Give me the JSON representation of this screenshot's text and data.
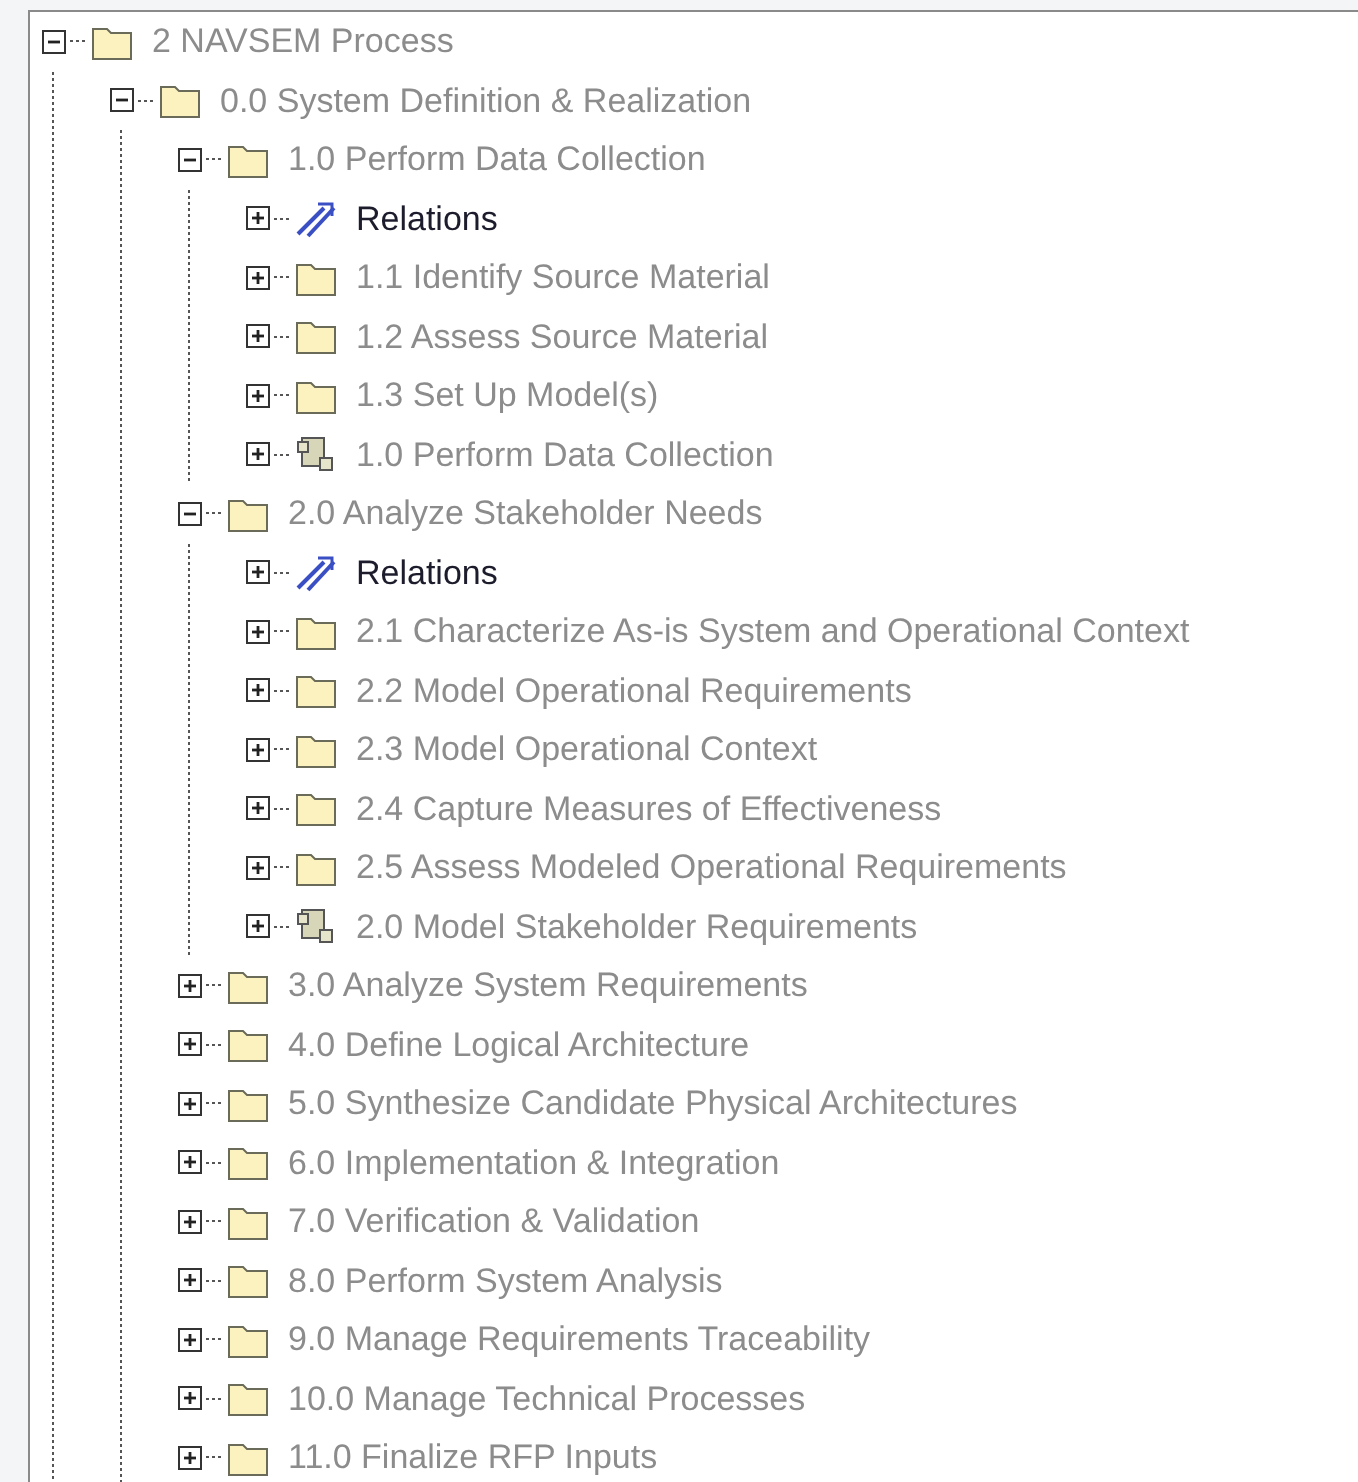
{
  "tree": [
    {
      "label": "2 NAVSEM Process",
      "kind": "folder",
      "expanded": true,
      "children": [
        {
          "label": "0.0 System Definition & Realization",
          "kind": "folder",
          "expanded": true,
          "children": [
            {
              "label": "1.0 Perform Data Collection",
              "kind": "folder",
              "expanded": true,
              "children": [
                {
                  "label": "Relations",
                  "kind": "relations",
                  "expanded": false
                },
                {
                  "label": "1.1 Identify Source Material",
                  "kind": "folder",
                  "expanded": false
                },
                {
                  "label": "1.2 Assess Source Material",
                  "kind": "folder",
                  "expanded": false
                },
                {
                  "label": "1.3 Set Up Model(s)",
                  "kind": "folder",
                  "expanded": false
                },
                {
                  "label": "1.0 Perform Data Collection",
                  "kind": "diagram",
                  "expanded": false
                }
              ]
            },
            {
              "label": "2.0 Analyze Stakeholder Needs",
              "kind": "folder",
              "expanded": true,
              "children": [
                {
                  "label": "Relations",
                  "kind": "relations",
                  "expanded": false
                },
                {
                  "label": "2.1 Characterize As-is System and Operational Context",
                  "kind": "folder",
                  "expanded": false
                },
                {
                  "label": "2.2 Model Operational Requirements",
                  "kind": "folder",
                  "expanded": false
                },
                {
                  "label": "2.3 Model Operational Context",
                  "kind": "folder",
                  "expanded": false
                },
                {
                  "label": "2.4 Capture Measures of Effectiveness",
                  "kind": "folder",
                  "expanded": false
                },
                {
                  "label": "2.5 Assess Modeled Operational Requirements",
                  "kind": "folder",
                  "expanded": false
                },
                {
                  "label": "2.0 Model Stakeholder Requirements",
                  "kind": "diagram",
                  "expanded": false
                }
              ]
            },
            {
              "label": "3.0 Analyze System Requirements",
              "kind": "folder",
              "expanded": false
            },
            {
              "label": "4.0 Define Logical Architecture",
              "kind": "folder",
              "expanded": false
            },
            {
              "label": "5.0 Synthesize Candidate Physical Architectures",
              "kind": "folder",
              "expanded": false
            },
            {
              "label": "6.0 Implementation & Integration",
              "kind": "folder",
              "expanded": false
            },
            {
              "label": "7.0 Verification & Validation",
              "kind": "folder",
              "expanded": false
            },
            {
              "label": "8.0 Perform System Analysis",
              "kind": "folder",
              "expanded": false
            },
            {
              "label": "9.0 Manage Requirements Traceability",
              "kind": "folder",
              "expanded": false
            },
            {
              "label": "10.0 Manage Technical Processes",
              "kind": "folder",
              "expanded": false
            },
            {
              "label": "11.0 Finalize RFP Inputs",
              "kind": "folder",
              "expanded": false
            }
          ]
        }
      ]
    }
  ]
}
